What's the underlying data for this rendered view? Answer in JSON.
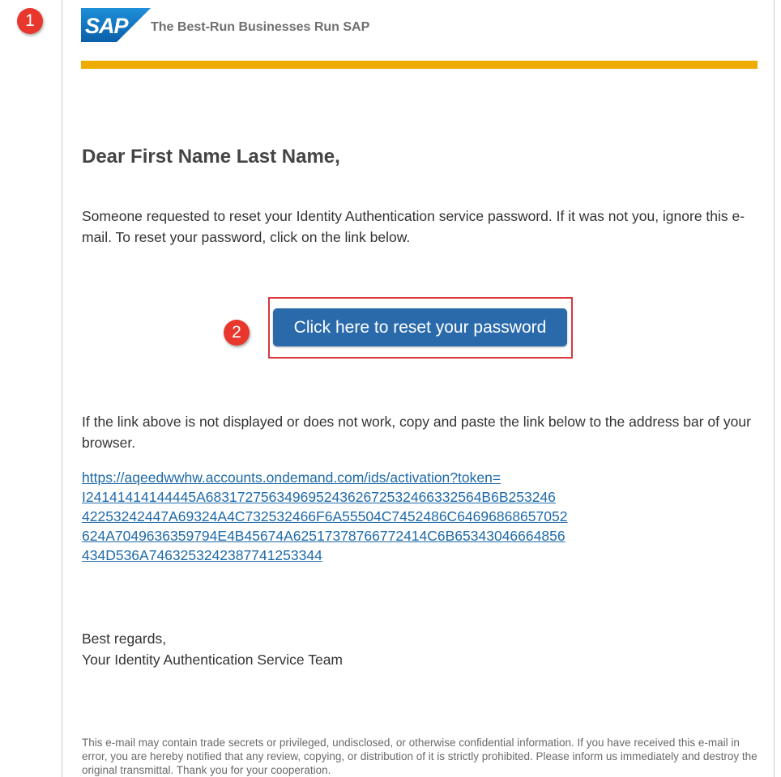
{
  "annotations": {
    "step1": "1",
    "step2": "2"
  },
  "header": {
    "logo_text": "SAP",
    "tagline": "The Best-Run Businesses Run SAP"
  },
  "colors": {
    "sap_blue": "#0a6ebd",
    "gold_bar": "#f0ab00",
    "button": "#2a6aab",
    "link": "#1f6aa8",
    "annotation_red": "#e8372d"
  },
  "email": {
    "greeting": "Dear First Name Last Name,",
    "intro": "Someone requested to reset your Identity Authentication service password. If it was not you, ignore this e-mail. To reset your password, click on the link below.",
    "reset_button_label": "Click here to reset your password",
    "fallback_text": "If the link above is not displayed or does not work, copy and paste the link below to the address bar of your browser.",
    "link_lines": [
      "https://aqeedwwhw.accounts.ondemand.com/ids/activation?token=",
      "I24141414144445A68317275634969524362672532466332564B6B253246",
      "42253242447A69324A4C732532466F6A55504C7452486C64696868657052",
      "624A7049636359794E4B45674A62517378766772414C6B65343046664856",
      "434D536A7463253242387741253344"
    ],
    "closing_line1": "Best regards,",
    "closing_line2": "Your Identity Authentication Service Team",
    "disclaimer": "This e-mail may contain trade secrets or privileged, undisclosed, or otherwise confidential information. If you have received this e-mail in error, you are hereby notified that any review, copying, or distribution of it is strictly prohibited. Please inform us immediately and destroy the original transmittal. Thank you for your cooperation."
  }
}
